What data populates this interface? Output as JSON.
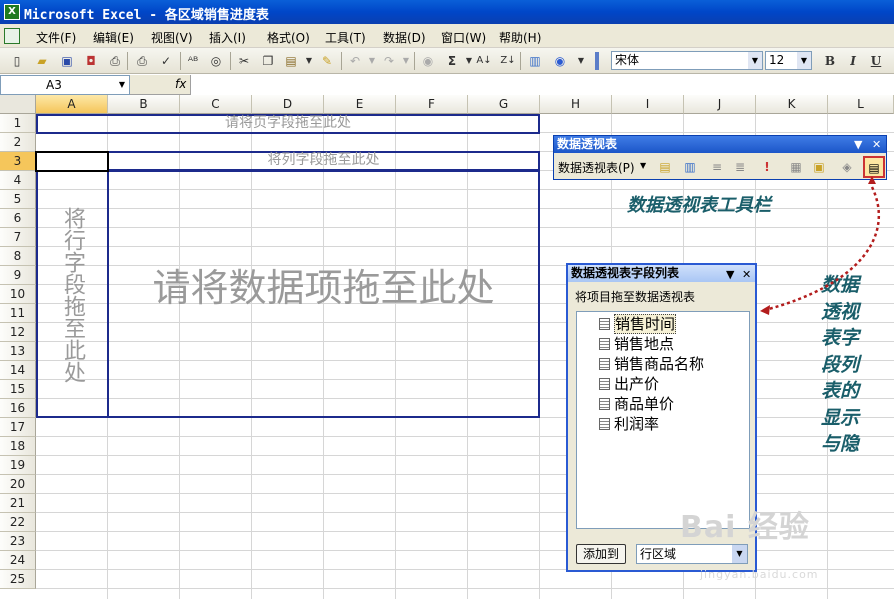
{
  "window": {
    "title": "Microsoft Excel - 各区域销售进度表"
  },
  "menu": [
    "文件(F)",
    "编辑(E)",
    "视图(V)",
    "插入(I)",
    "格式(O)",
    "工具(T)",
    "数据(D)",
    "窗口(W)",
    "帮助(H)"
  ],
  "toolbar": {
    "icons": [
      "new-icon",
      "open-icon",
      "save-icon",
      "permission-icon",
      "print-icon",
      "print-preview-icon",
      "spelling-icon",
      "research-icon",
      "cut-icon",
      "copy-icon",
      "paste-icon",
      "format-painter-icon",
      "undo-icon",
      "redo-icon",
      "hyperlink-icon",
      "autosum-icon",
      "sort-ascending-icon",
      "sort-descending-icon",
      "chart-wizard-icon",
      "help-icon"
    ],
    "font_name": "宋体",
    "font_size": "12",
    "bold": "B",
    "italic": "I",
    "underline": "U"
  },
  "formula_bar": {
    "name_box": "A3",
    "fx": "fx",
    "value": ""
  },
  "grid": {
    "columns": [
      "A",
      "B",
      "C",
      "D",
      "E",
      "F",
      "G",
      "H",
      "I",
      "J",
      "K",
      "L"
    ],
    "rows": [
      "1",
      "2",
      "3",
      "4",
      "5",
      "6",
      "7",
      "8",
      "9",
      "10",
      "11",
      "12",
      "13",
      "14",
      "15",
      "16",
      "17",
      "18",
      "19",
      "20",
      "21",
      "22",
      "23",
      "24",
      "25"
    ],
    "selected_column": "A",
    "selected_row": "3"
  },
  "pivot": {
    "page_area": "请将页字段拖至此处",
    "column_area": "将列字段拖至此处",
    "row_area": "将行字段拖至此处",
    "data_area": "请将数据项拖至此处"
  },
  "pivot_toolbar": {
    "title": "数据透视表",
    "menu_label": "数据透视表(P)",
    "icons": [
      "format-report-icon",
      "chart-wizard-icon",
      "hide-detail-icon",
      "show-detail-icon",
      "refresh-icon",
      "include-hidden-icon",
      "field-settings-icon",
      "show-field-list-icon"
    ]
  },
  "field_list": {
    "title": "数据透视表字段列表",
    "subtitle": "将项目拖至数据透视表",
    "items": [
      "销售时间",
      "销售地点",
      "销售商品名称",
      "出产价",
      "商品单价",
      "利润率"
    ],
    "add_button": "添加到",
    "area_select": "行区域"
  },
  "annotations": {
    "toolbar_note": "数据透视表工具栏",
    "field_list_note": "数据透视表字段列表的显示与隐"
  },
  "watermark": {
    "text": "Bai 经验",
    "sub": "jingyan.baidu.com"
  }
}
